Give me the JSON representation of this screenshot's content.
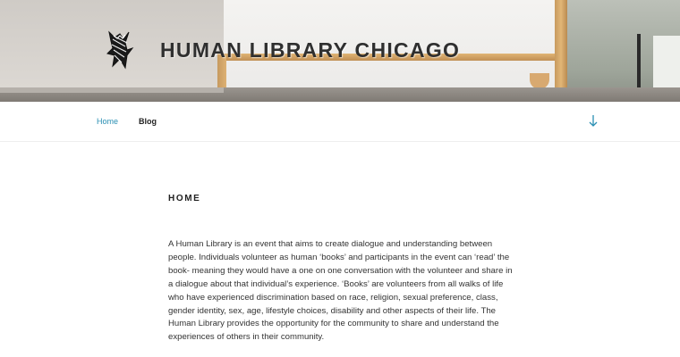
{
  "site": {
    "title": "HUMAN LIBRARY CHICAGO",
    "logo_icon": "scribble-figure-logo"
  },
  "nav": {
    "items": [
      {
        "label": "Home",
        "active": true
      },
      {
        "label": "Blog",
        "active": false
      }
    ],
    "scroll_icon": "arrow-down-icon",
    "accent_color": "#2a8fb3"
  },
  "page": {
    "title": "HOME",
    "body": "A Human Library is an event that aims to create dialogue and understanding between people. Individuals volunteer as human ‘books’ and participants in the event can ‘read’ the book- meaning they would have a one on one conversation with the volunteer and share in a dialogue about that individual’s experience. ‘Books’ are volunteers from all walks of life who have experienced discrimination based on race, religion, sexual preference, class, gender identity, sex, age, lifestyle choices, disability and other aspects of their life. The Human Library provides the opportunity for the community to share and understand the experiences of others in their community."
  }
}
